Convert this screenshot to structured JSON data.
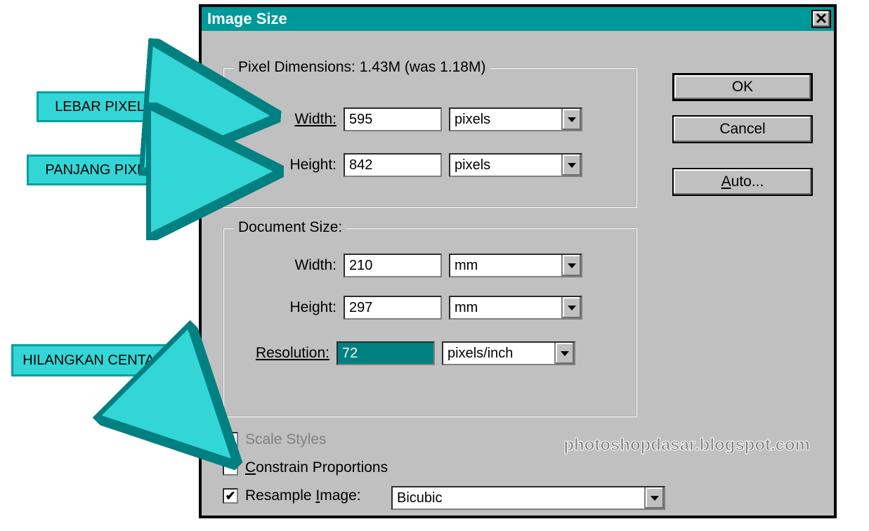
{
  "dialog": {
    "title": "Image Size",
    "pixel_dimensions_label": "Pixel Dimensions:  1.43M (was 1.18M)",
    "width_label": "Width:",
    "height_label": "Height:",
    "resolution_label": "Resolution:",
    "pixel_width_value": "595",
    "pixel_height_value": "842",
    "pixel_width_unit": "pixels",
    "pixel_height_unit": "pixels",
    "document_size_label": "Document Size:",
    "doc_width_value": "210",
    "doc_height_value": "297",
    "doc_width_unit": "mm",
    "doc_height_unit": "mm",
    "resolution_value": "72",
    "resolution_unit": "pixels/inch",
    "scale_styles_label": "Scale Styles",
    "constrain_proportions_label": "Constrain Proportions",
    "resample_image_label": "Resample Image:",
    "resample_method": "Bicubic",
    "ok_label": "OK",
    "cancel_label": "Cancel",
    "auto_label": "Auto..."
  },
  "callouts": {
    "lebar_pixel": "LEBAR PIXEL",
    "panjang_pixel": "PANJANG PIXEL",
    "hilangkan_centang": "HILANGKAN CENTANG"
  },
  "watermark": "photoshopdasar.blogspot.com",
  "colors": {
    "titlebar_bg": "#009999",
    "callout_bg": "#33d6d6",
    "callout_border": "#00a0a0"
  }
}
